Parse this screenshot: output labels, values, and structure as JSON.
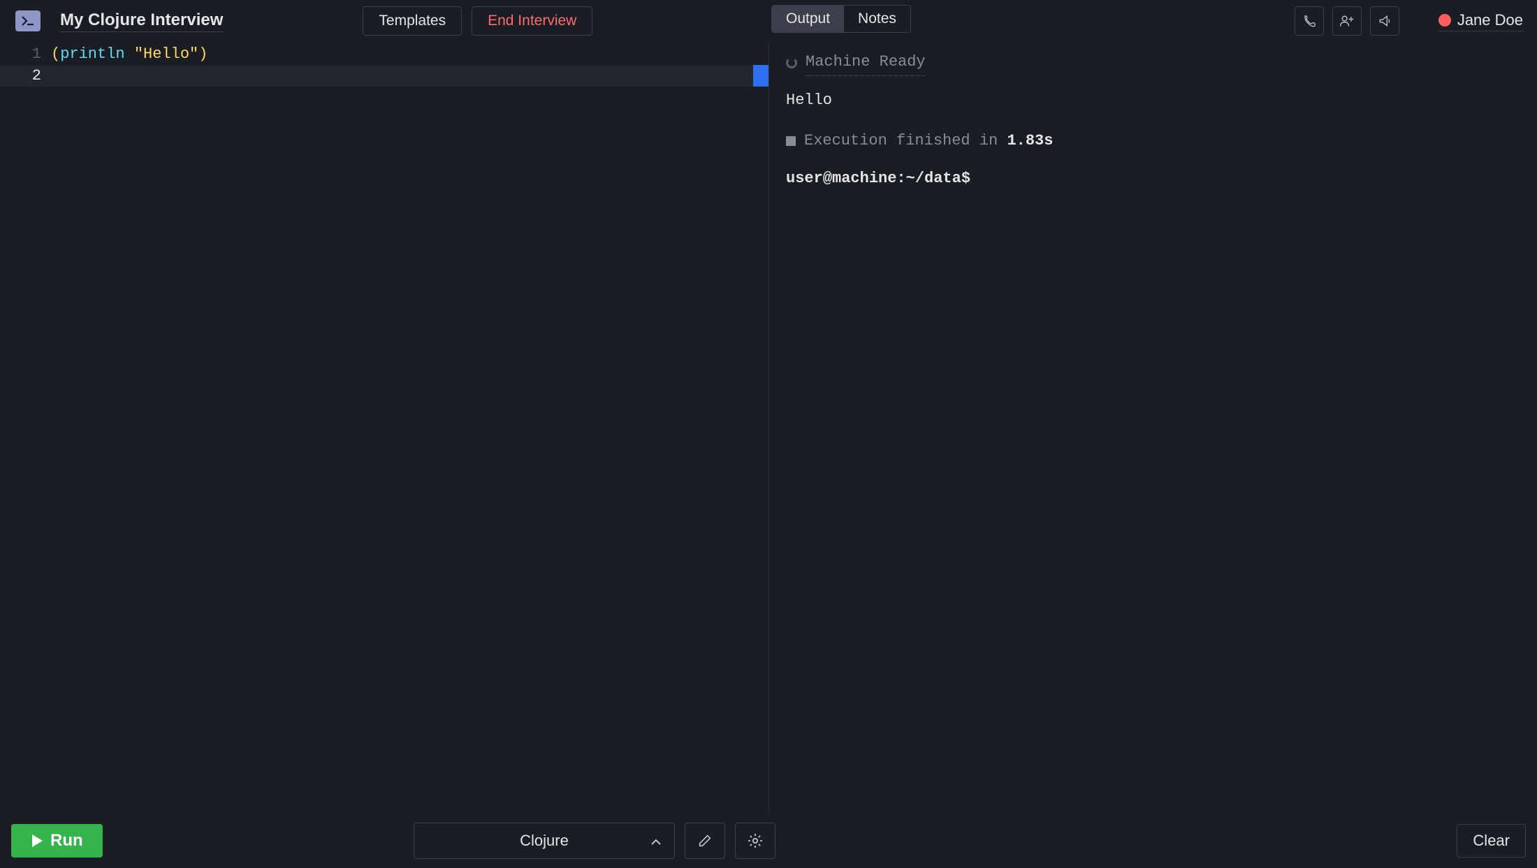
{
  "header": {
    "title": "My Clojure Interview",
    "templates_label": "Templates",
    "end_interview_label": "End Interview",
    "tabs": {
      "output": "Output",
      "notes": "Notes"
    },
    "user": {
      "name": "Jane Doe",
      "status_color": "#ff5e5e"
    }
  },
  "editor": {
    "language": "Clojure",
    "lines": [
      {
        "num": "1",
        "paren_open": "(",
        "fn": "println",
        "space": " ",
        "str": "\"Hello\"",
        "paren_close": ")"
      },
      {
        "num": "2"
      }
    ],
    "active_line_index": 1
  },
  "output": {
    "machine_status": "Machine Ready",
    "stdout": "Hello",
    "exec_prefix": "Execution finished in ",
    "exec_time": "1.83s",
    "prompt": "user@machine:~/data$"
  },
  "footer": {
    "run_label": "Run",
    "language_select": "Clojure",
    "clear_label": "Clear"
  }
}
